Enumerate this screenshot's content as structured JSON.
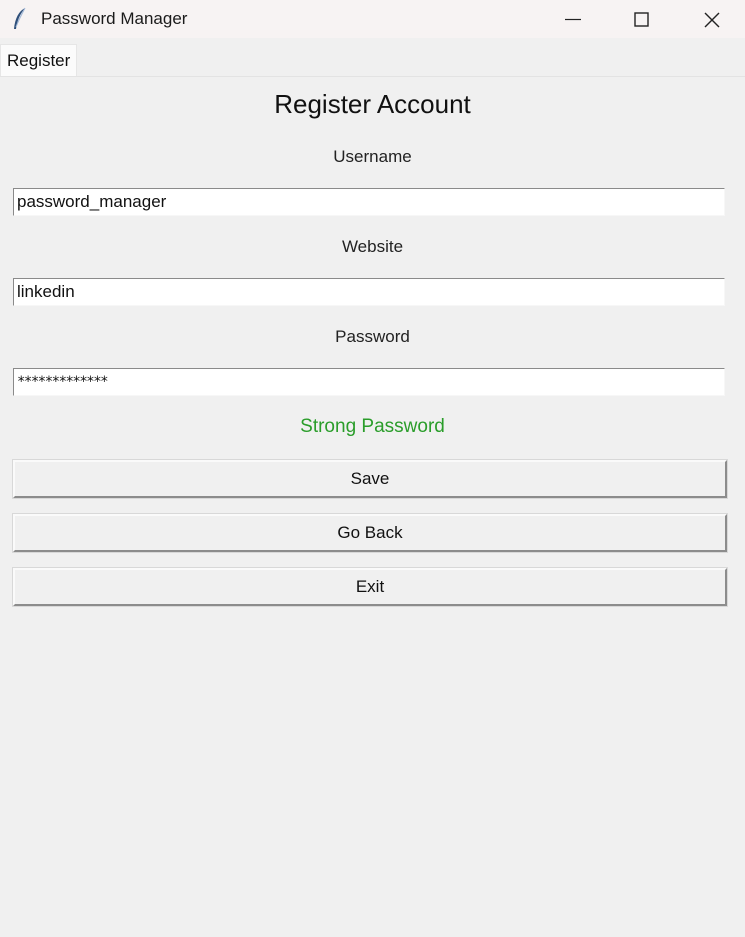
{
  "window": {
    "title": "Password Manager"
  },
  "menubar": {
    "tabs": [
      {
        "label": "Register"
      }
    ]
  },
  "form": {
    "heading": "Register Account",
    "username": {
      "label": "Username",
      "value": "password_manager"
    },
    "website": {
      "label": "Website",
      "value": "linkedin"
    },
    "password": {
      "label": "Password",
      "value": "*************"
    },
    "strength": {
      "text": "Strong Password",
      "color": "#2a9d2a"
    }
  },
  "buttons": {
    "save": "Save",
    "back": "Go Back",
    "exit": "Exit"
  },
  "icons": {
    "app": "feather-icon",
    "minimize": "minimize-icon",
    "maximize": "maximize-icon",
    "close": "close-icon"
  }
}
